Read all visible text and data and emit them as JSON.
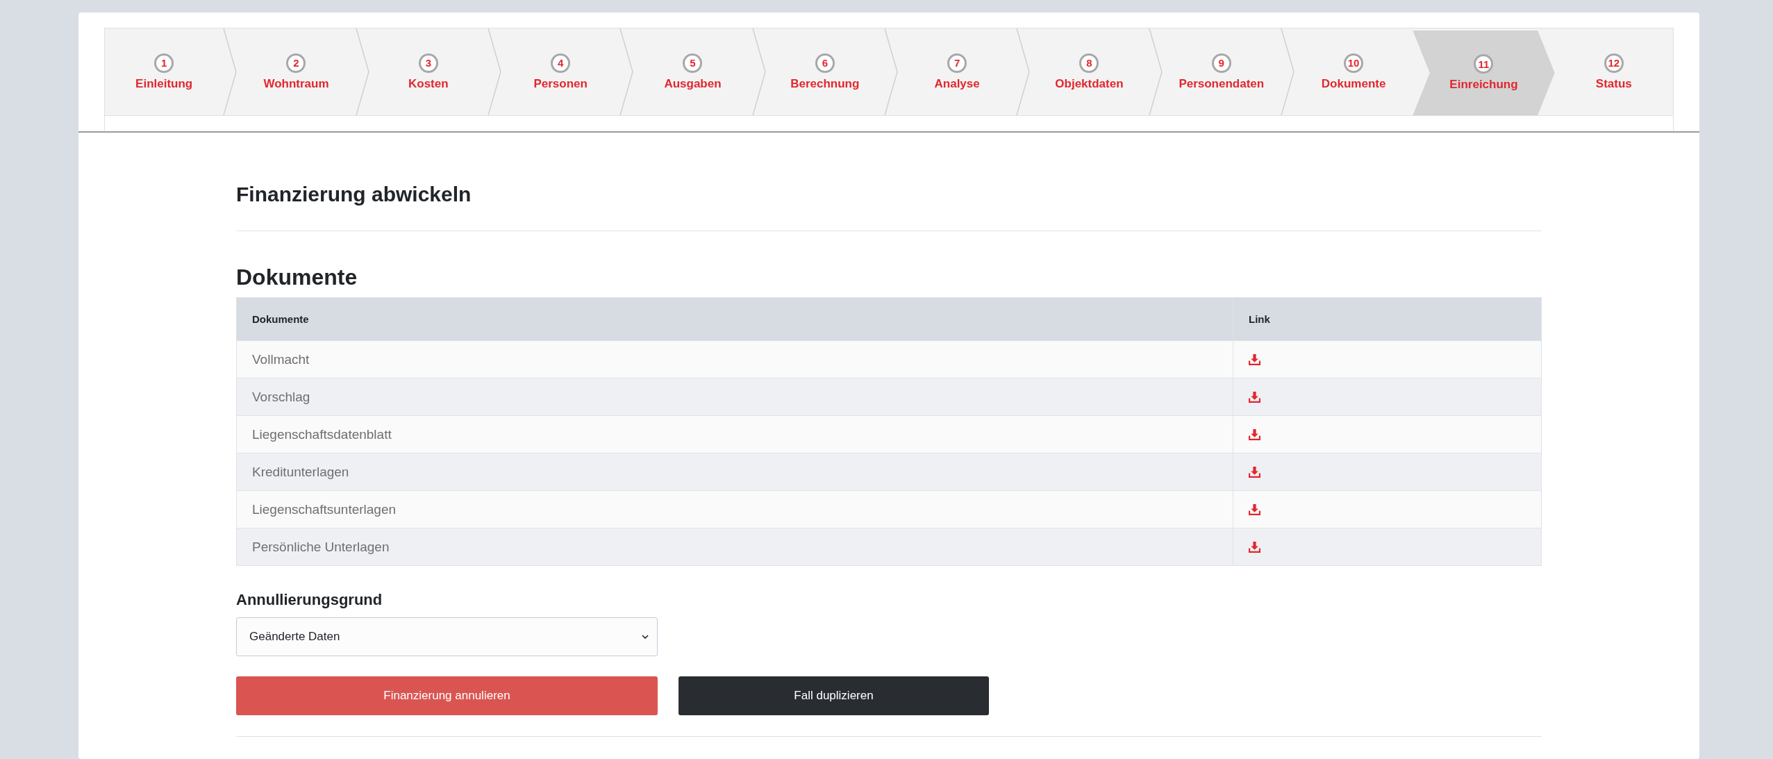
{
  "steps": [
    {
      "number": "1",
      "label": "Einleitung",
      "selected": false
    },
    {
      "number": "2",
      "label": "Wohntraum",
      "selected": false
    },
    {
      "number": "3",
      "label": "Kosten",
      "selected": false
    },
    {
      "number": "4",
      "label": "Personen",
      "selected": false
    },
    {
      "number": "5",
      "label": "Ausgaben",
      "selected": false
    },
    {
      "number": "6",
      "label": "Berechnung",
      "selected": false
    },
    {
      "number": "7",
      "label": "Analyse",
      "selected": false
    },
    {
      "number": "8",
      "label": "Objektdaten",
      "selected": false
    },
    {
      "number": "9",
      "label": "Personendaten",
      "selected": false
    },
    {
      "number": "10",
      "label": "Dokumente",
      "selected": false
    },
    {
      "number": "11",
      "label": "Einreichung",
      "selected": true
    },
    {
      "number": "12",
      "label": "Status",
      "selected": false
    }
  ],
  "page_title": "Finanzierung abwickeln",
  "documents": {
    "heading": "Dokumente",
    "columns": [
      "Dokumente",
      "Link"
    ],
    "rows": [
      {
        "name": "Vollmacht"
      },
      {
        "name": "Vorschlag"
      },
      {
        "name": "Liegenschaftsdatenblatt"
      },
      {
        "name": "Kreditunterlagen"
      },
      {
        "name": "Liegenschaftsunterlagen"
      },
      {
        "name": "Persönliche Unterlagen"
      }
    ]
  },
  "cancel_reason": {
    "label": "Annullierungsgrund",
    "value": "Geänderte Daten"
  },
  "buttons": [
    {
      "label": "Finanzierung annulieren",
      "kind": "danger"
    },
    {
      "label": "Fall duplizieren",
      "kind": "dark"
    }
  ]
}
